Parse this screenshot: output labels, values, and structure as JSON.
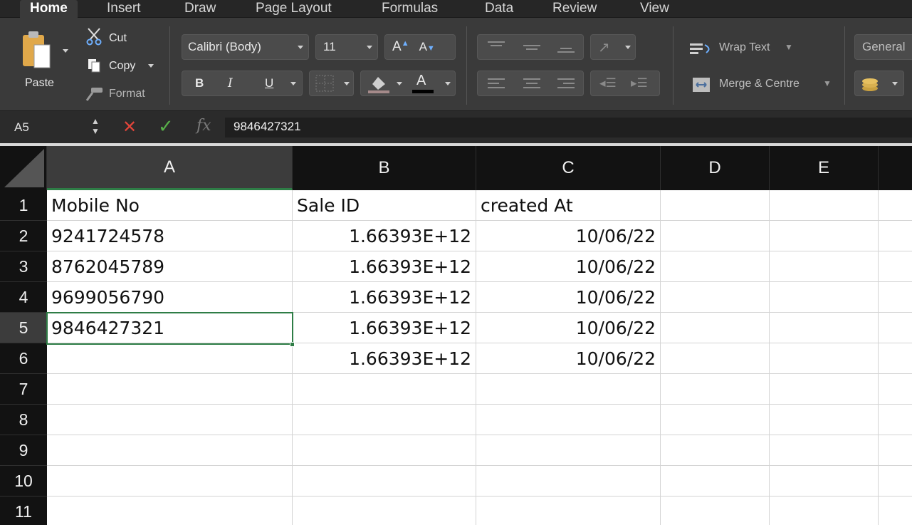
{
  "ribbon_tabs": [
    "Home",
    "Insert",
    "Draw",
    "Page Layout",
    "Formulas",
    "Data",
    "Review",
    "View"
  ],
  "clipboard": {
    "paste": "Paste",
    "cut": "Cut",
    "copy": "Copy",
    "format": "Format"
  },
  "font": {
    "name": "Calibri (Body)",
    "size": "11",
    "bold": "B",
    "italic": "I",
    "underline": "U",
    "font_color_label": "A",
    "grow": "A",
    "shrink": "A"
  },
  "alignment": {
    "wrap_text": "Wrap Text",
    "merge_centre": "Merge & Centre"
  },
  "number": {
    "format": "General"
  },
  "formula_bar": {
    "name_box": "A5",
    "fx": "fx",
    "value": "9846427321"
  },
  "accent_color": "#2e7d46",
  "grid": {
    "columns": [
      "A",
      "B",
      "C",
      "D",
      "E"
    ],
    "rows": [
      "1",
      "2",
      "3",
      "4",
      "5",
      "6",
      "7",
      "8",
      "9",
      "10",
      "11"
    ],
    "active_cell": "A5",
    "cells": {
      "r1": {
        "a": "Mobile No",
        "b": "Sale ID",
        "c": "created At"
      },
      "r2": {
        "a": "9241724578",
        "b": "1.66393E+12",
        "c": "10/06/22"
      },
      "r3": {
        "a": "8762045789",
        "b": "1.66393E+12",
        "c": "10/06/22"
      },
      "r4": {
        "a": "9699056790",
        "b": "1.66393E+12",
        "c": "10/06/22"
      },
      "r5": {
        "a": "9846427321",
        "b": "1.66393E+12",
        "c": "10/06/22"
      },
      "r6": {
        "a": "",
        "b": "1.66393E+12",
        "c": "10/06/22"
      }
    }
  }
}
